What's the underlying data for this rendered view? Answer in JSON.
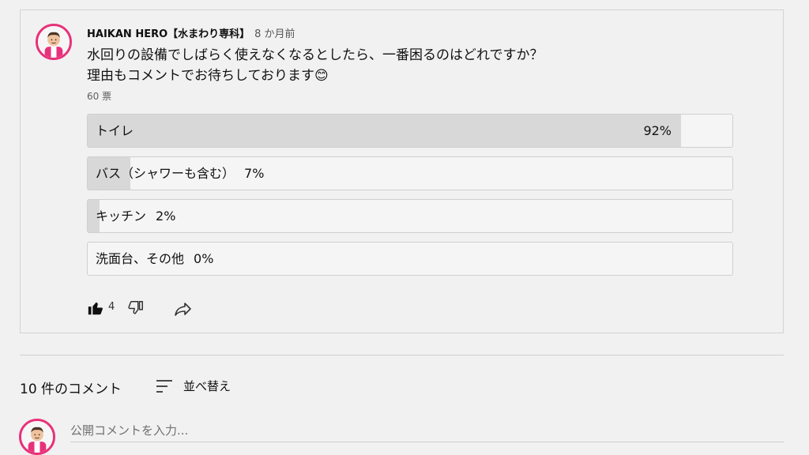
{
  "post": {
    "author": "HAIKAN HERO【水まわり専科】",
    "time": "8 か月前",
    "text_line1": "水回りの設備でしばらく使えなくなるとしたら、一番困るのはどれですか？",
    "text_line2": "理由もコメントでお待ちしております😊",
    "votes": "60 票",
    "options": [
      {
        "label": "トイレ",
        "percent_text": "92%",
        "percent": 92
      },
      {
        "label": "バス（シャワーも含む）",
        "percent_text": "7%",
        "percent": 7
      },
      {
        "label": "キッチン",
        "percent_text": "2%",
        "percent": 2
      },
      {
        "label": "洗面台、その他",
        "percent_text": "0%",
        "percent": 0
      }
    ],
    "like_count": "4"
  },
  "comments": {
    "count_label": "10 件のコメント",
    "sort_label": "並べ替え",
    "input_placeholder": "公開コメントを入力..."
  },
  "colors": {
    "avatar_ring": "#e8317a",
    "fill": "#d8d8d8"
  },
  "icons": [
    "avatar-icon",
    "thumbs-up-icon",
    "thumbs-down-icon",
    "share-icon",
    "sort-icon"
  ]
}
